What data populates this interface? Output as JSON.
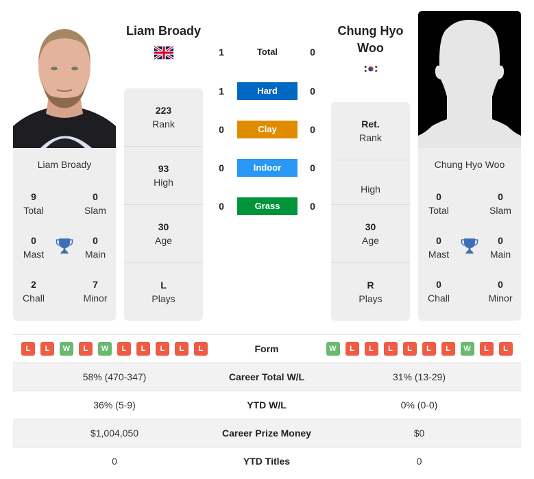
{
  "players": {
    "left": {
      "name": "Liam Broady",
      "card_name": "Liam Broady",
      "flag": "uk-flag-icon",
      "rank": {
        "value": "223",
        "label": "Rank"
      },
      "high": {
        "value": "93",
        "label": "High"
      },
      "age": {
        "value": "30",
        "label": "Age"
      },
      "plays": {
        "value": "L",
        "label": "Plays"
      },
      "titles": {
        "total": {
          "value": "9",
          "label": "Total"
        },
        "slam": {
          "value": "0",
          "label": "Slam"
        },
        "mast": {
          "value": "0",
          "label": "Mast"
        },
        "main": {
          "value": "0",
          "label": "Main"
        },
        "chall": {
          "value": "2",
          "label": "Chall"
        },
        "minor": {
          "value": "7",
          "label": "Minor"
        }
      }
    },
    "right": {
      "name": "Chung Hyo Woo",
      "card_name": "Chung Hyo Woo",
      "flag": "south-korea-flag-icon",
      "rank": {
        "value": "Ret.",
        "label": "Rank"
      },
      "high": {
        "value": "",
        "label": "High"
      },
      "age": {
        "value": "30",
        "label": "Age"
      },
      "plays": {
        "value": "R",
        "label": "Plays"
      },
      "titles": {
        "total": {
          "value": "0",
          "label": "Total"
        },
        "slam": {
          "value": "0",
          "label": "Slam"
        },
        "mast": {
          "value": "0",
          "label": "Mast"
        },
        "main": {
          "value": "0",
          "label": "Main"
        },
        "chall": {
          "value": "0",
          "label": "Chall"
        },
        "minor": {
          "value": "0",
          "label": "Minor"
        }
      }
    }
  },
  "h2h": [
    {
      "label": "Total",
      "left": "1",
      "right": "0",
      "color": ""
    },
    {
      "label": "Hard",
      "left": "1",
      "right": "0",
      "color": "#0067c3"
    },
    {
      "label": "Clay",
      "left": "0",
      "right": "0",
      "color": "#df8c00"
    },
    {
      "label": "Indoor",
      "left": "0",
      "right": "0",
      "color": "#2897f5"
    },
    {
      "label": "Grass",
      "left": "0",
      "right": "0",
      "color": "#00953a"
    }
  ],
  "form": {
    "label": "Form",
    "left": [
      "L",
      "L",
      "W",
      "L",
      "W",
      "L",
      "L",
      "L",
      "L",
      "L"
    ],
    "right": [
      "W",
      "L",
      "L",
      "L",
      "L",
      "L",
      "L",
      "W",
      "L",
      "L"
    ],
    "colors": {
      "W": "#69b96f",
      "L": "#ee5c44"
    }
  },
  "stats": [
    {
      "label": "Career Total W/L",
      "left": "58% (470-347)",
      "right": "31% (13-29)"
    },
    {
      "label": "YTD W/L",
      "left": "36% (5-9)",
      "right": "0% (0-0)"
    },
    {
      "label": "Career Prize Money",
      "left": "$1,004,050",
      "right": "$0"
    },
    {
      "label": "YTD Titles",
      "left": "0",
      "right": "0"
    }
  ]
}
